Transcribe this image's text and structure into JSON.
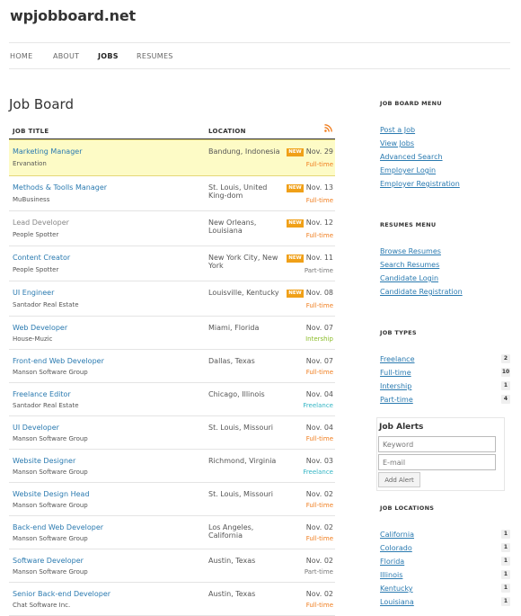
{
  "site": {
    "title": "wpjobboard.net"
  },
  "nav": {
    "items": [
      "HOME",
      "ABOUT",
      "JOBS",
      "RESUMES"
    ],
    "active": "JOBS"
  },
  "page": {
    "title": "Job Board"
  },
  "table": {
    "headers": {
      "title": "JOB TITLE",
      "location": "LOCATION"
    },
    "rss_icon": "rss-icon",
    "new_badge": "NEW",
    "rows": [
      {
        "title": "Marketing Manager",
        "company": "Ervanation",
        "location": "Bandung, Indonesia",
        "date": "Nov. 29",
        "is_new": true,
        "type": "Full-time",
        "featured": true
      },
      {
        "title": "Methods & Toolls Manager",
        "company": "MuBusiness",
        "location": "St. Louis, United King-dom",
        "date": "Nov. 13",
        "is_new": true,
        "type": "Full-time"
      },
      {
        "title": "Lead Developer",
        "company": "People Spotter",
        "location": "New Orleans, Louisiana",
        "date": "Nov. 12",
        "is_new": true,
        "type": "Full-time",
        "grey": true
      },
      {
        "title": "Content Creator",
        "company": "People Spotter",
        "location": "New York City, New York",
        "date": "Nov. 11",
        "is_new": true,
        "type": "Part-time"
      },
      {
        "title": "UI Engineer",
        "company": "Santador Real Estate",
        "location": "Louisville, Kentucky",
        "date": "Nov. 08",
        "is_new": true,
        "type": "Full-time"
      },
      {
        "title": "Web Developer",
        "company": "House-Muzic",
        "location": "Miami, Florida",
        "date": "Nov. 07",
        "is_new": false,
        "type": "Intership"
      },
      {
        "title": "Front-end Web Developer",
        "company": "Manson Software Group",
        "location": "Dallas, Texas",
        "date": "Nov. 07",
        "is_new": false,
        "type": "Full-time"
      },
      {
        "title": "Freelance Editor",
        "company": "Santador Real Estate",
        "location": "Chicago, Illinois",
        "date": "Nov. 04",
        "is_new": false,
        "type": "Freelance"
      },
      {
        "title": "UI Developer",
        "company": "Manson Software Group",
        "location": "St. Louis, Missouri",
        "date": "Nov. 04",
        "is_new": false,
        "type": "Full-time"
      },
      {
        "title": "Website Designer",
        "company": "Manson Software Group",
        "location": "Richmond, Virginia",
        "date": "Nov. 03",
        "is_new": false,
        "type": "Freelance"
      },
      {
        "title": "Website Design Head",
        "company": "Manson Software Group",
        "location": "St. Louis, Missouri",
        "date": "Nov. 02",
        "is_new": false,
        "type": "Full-time"
      },
      {
        "title": "Back-end Web Developer",
        "company": "Manson Software Group",
        "location": "Los Angeles, California",
        "date": "Nov. 02",
        "is_new": false,
        "type": "Full-time"
      },
      {
        "title": "Software Developer",
        "company": "Manson Software Group",
        "location": "Austin, Texas",
        "date": "Nov. 02",
        "is_new": false,
        "type": "Part-time"
      },
      {
        "title": "Senior Back-end Developer",
        "company": "Chat Software Inc.",
        "location": "Austin, Texas",
        "date": "Nov. 02",
        "is_new": false,
        "type": "Full-time"
      }
    ]
  },
  "type_colors": {
    "Full-time": "#f07c1c",
    "Part-time": "#777777",
    "Intership": "#8cbd2a",
    "Freelance": "#33b5c4"
  },
  "sidebar": {
    "job_board_menu": {
      "heading": "JOB BOARD MENU",
      "links": [
        "Post a Job",
        "View Jobs",
        "Advanced Search",
        "Employer Login",
        "Employer Registration"
      ]
    },
    "resumes_menu": {
      "heading": "RESUMES MENU",
      "links": [
        "Browse Resumes",
        "Search Resumes",
        "Candidate Login",
        "Candidate Registration"
      ]
    },
    "job_types": {
      "heading": "JOB TYPES",
      "items": [
        {
          "label": "Freelance",
          "count": "2"
        },
        {
          "label": "Full-time",
          "count": "10"
        },
        {
          "label": "Intership",
          "count": "1"
        },
        {
          "label": "Part-time",
          "count": "4"
        }
      ]
    },
    "job_alerts": {
      "heading": "Job Alerts",
      "keyword_placeholder": "Keyword",
      "email_placeholder": "E-mail",
      "button": "Add Alert"
    },
    "job_locations": {
      "heading": "JOB LOCATIONS",
      "items": [
        {
          "label": "California",
          "count": "1"
        },
        {
          "label": "Colorado",
          "count": "1"
        },
        {
          "label": "Florida",
          "count": "1"
        },
        {
          "label": "Illinois",
          "count": "1"
        },
        {
          "label": "Kentucky",
          "count": "1"
        },
        {
          "label": "Louisiana",
          "count": "1"
        }
      ]
    }
  }
}
